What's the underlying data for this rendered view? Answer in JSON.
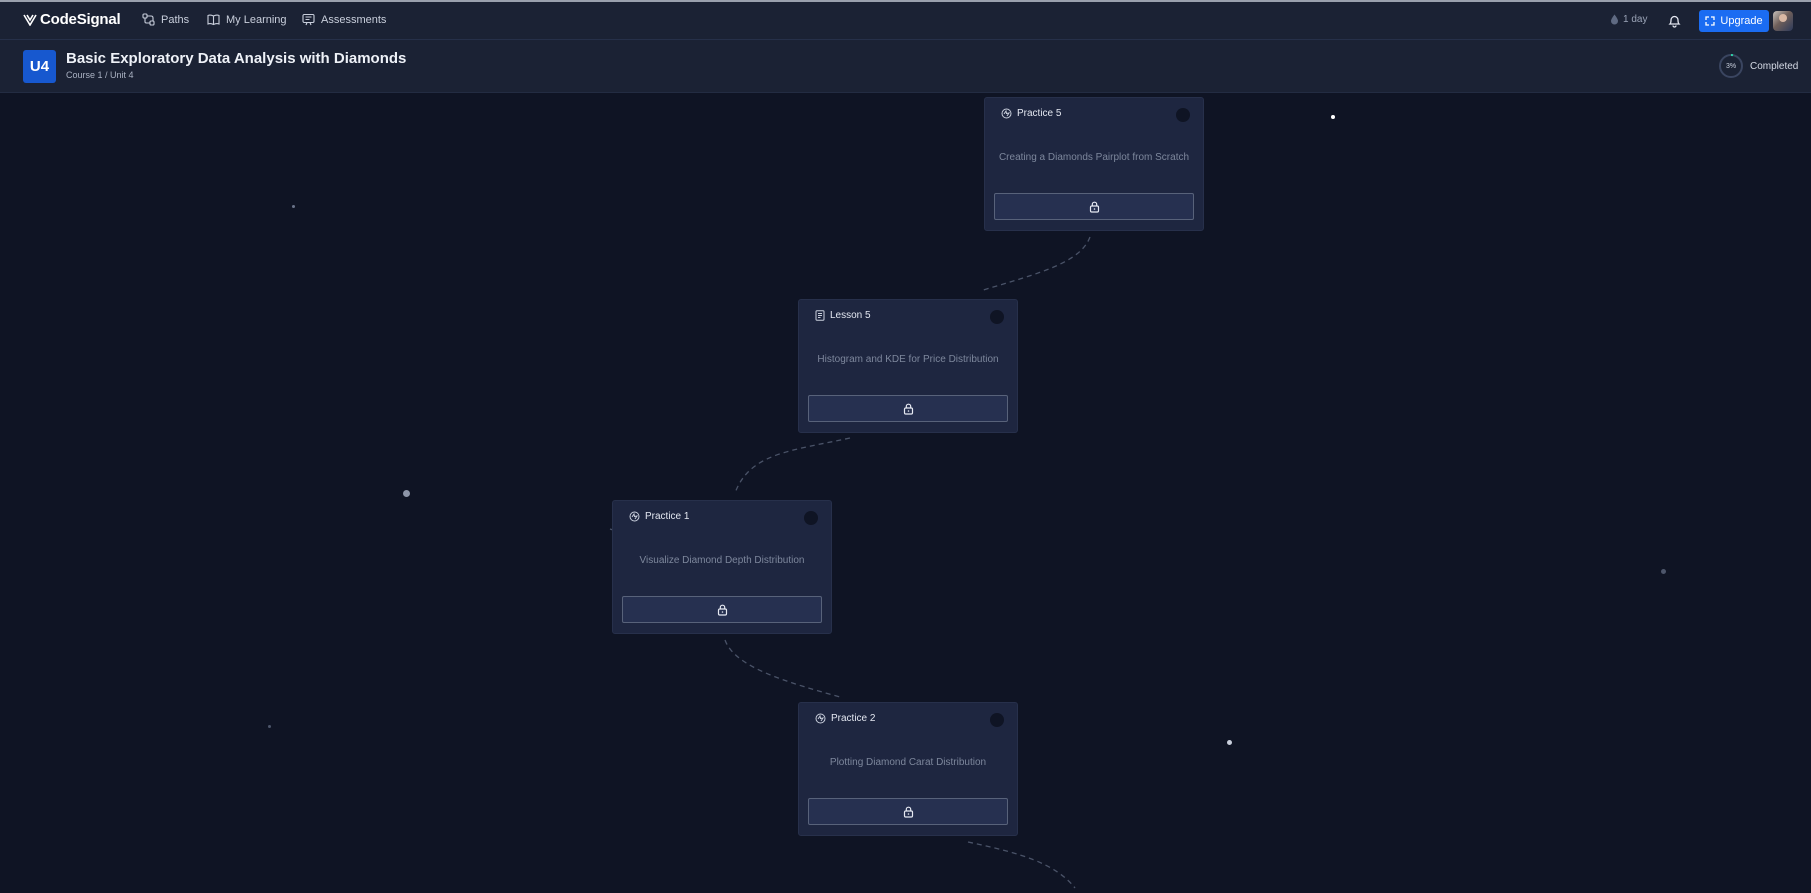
{
  "app": {
    "brand": "CodeSignal",
    "nav": [
      {
        "label": "Paths",
        "icon": "paths-icon"
      },
      {
        "label": "My Learning",
        "icon": "book-icon"
      },
      {
        "label": "Assessments",
        "icon": "assessment-icon"
      }
    ],
    "streak_label": "1 day",
    "upgrade_label": "Upgrade"
  },
  "unit": {
    "badge": "U4",
    "title": "Basic Exploratory Data Analysis with Diamonds",
    "breadcrumb": "Course 1 / Unit 4",
    "progress_percent": 3,
    "progress_text": "3%",
    "progress_label": "Completed"
  },
  "cards": [
    {
      "type": "Practice 5",
      "kind": "practice",
      "title": "Creating a Diamonds Pairplot from Scratch",
      "locked": true
    },
    {
      "type": "Lesson 5",
      "kind": "lesson",
      "title": "Histogram and KDE for Price Distribution",
      "locked": true
    },
    {
      "type": "Practice 1",
      "kind": "practice",
      "title": "Visualize Diamond Depth Distribution",
      "locked": true
    },
    {
      "type": "Practice 2",
      "kind": "practice",
      "title": "Plotting Diamond Carat Distribution",
      "locked": true
    }
  ],
  "colors": {
    "background": "#0f1424",
    "navbar": "#1b2234",
    "card": "#1e2640",
    "accent": "#1b6cf2",
    "badge": "#1758cf"
  }
}
